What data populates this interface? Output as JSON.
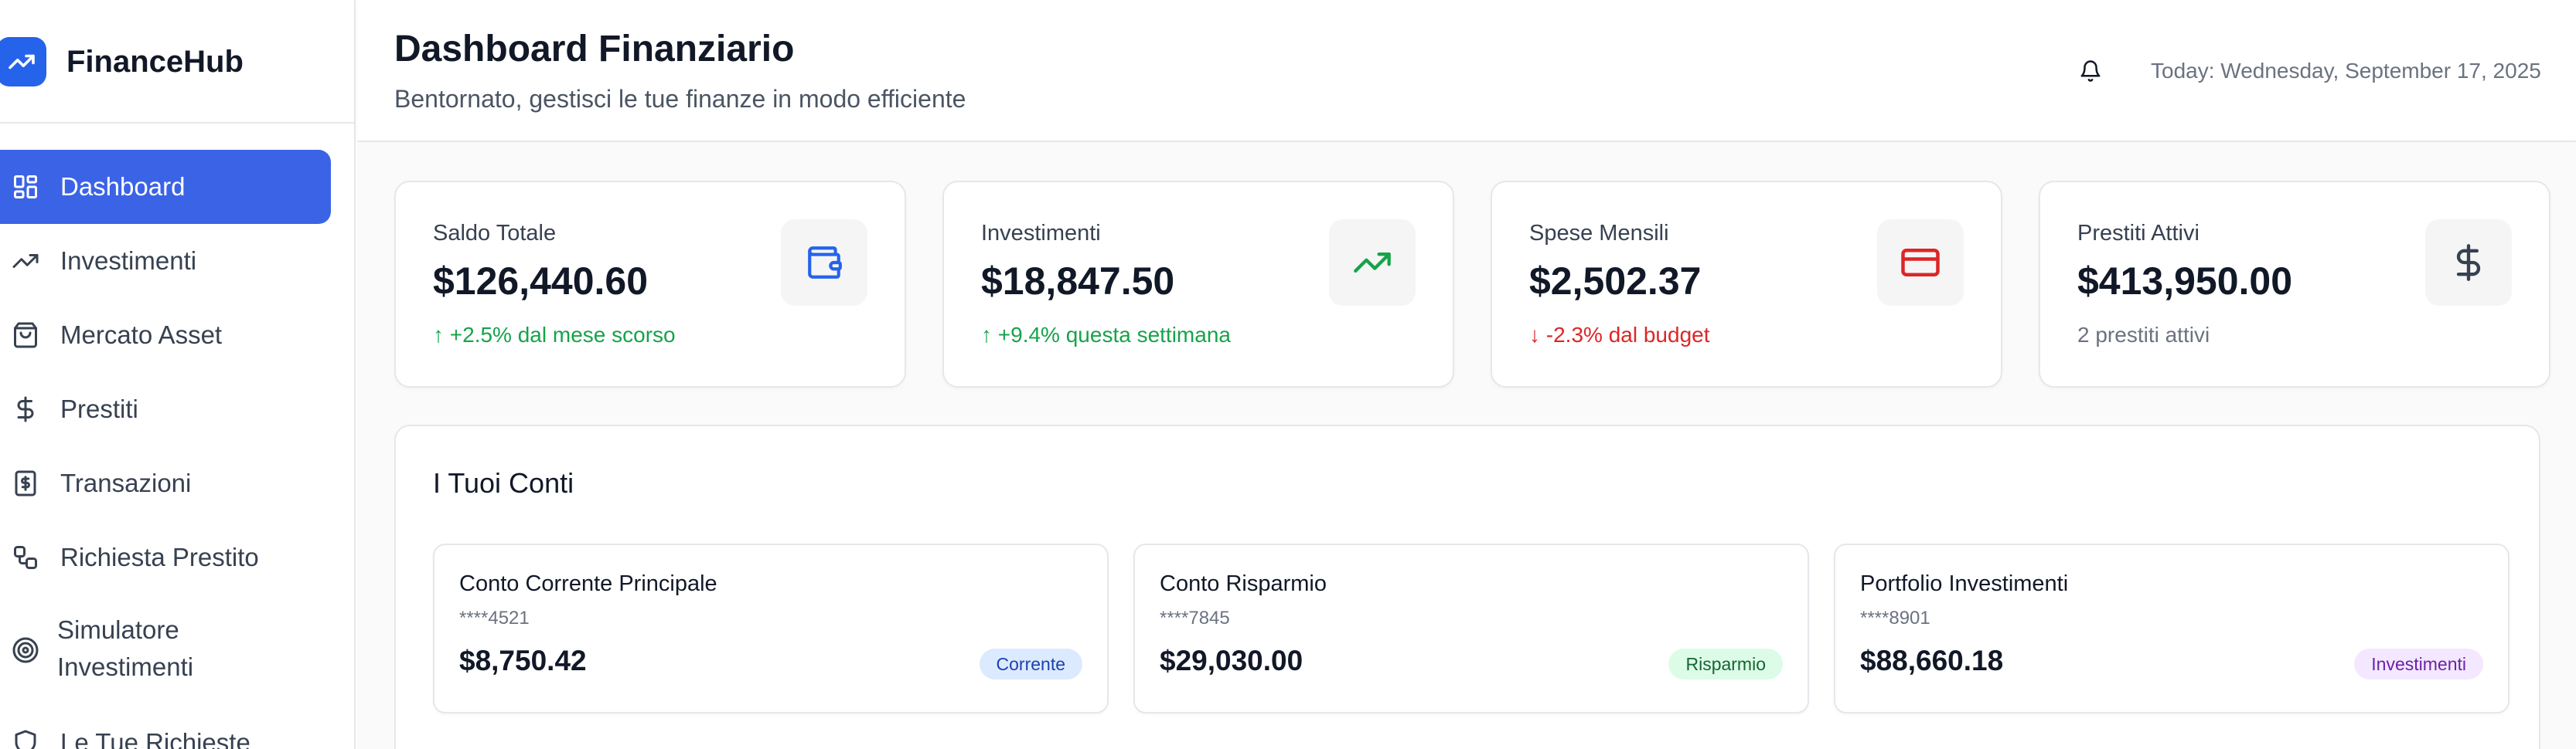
{
  "app": {
    "name": "FinanceHub"
  },
  "sidebar": {
    "items": [
      {
        "label": "Dashboard",
        "icon": "layout-grid-icon"
      },
      {
        "label": "Investimenti",
        "icon": "trending-up-icon"
      },
      {
        "label": "Mercato Asset",
        "icon": "shopping-bag-icon"
      },
      {
        "label": "Prestiti",
        "icon": "dollar-sign-icon"
      },
      {
        "label": "Transazioni",
        "icon": "receipt-icon"
      },
      {
        "label": "Richiesta Prestito",
        "icon": "workflow-icon"
      },
      {
        "label": "Simulatore Investimenti",
        "label_line1": "Simulatore",
        "label_line2": "Investimenti",
        "icon": "target-icon"
      },
      {
        "label": "Le Tue Richieste",
        "icon": "shield-icon"
      }
    ],
    "active_item": "Dashboard"
  },
  "header": {
    "title": "Dashboard Finanziario",
    "subtitle": "Bentornato, gestisci le tue finanze in modo efficiente",
    "today": "Today: Wednesday, September 17, 2025"
  },
  "stats": [
    {
      "label": "Saldo Totale",
      "value": "$126,440.60",
      "sub": "↑ +2.5% dal mese scorso",
      "trend": "up",
      "icon": "wallet-icon",
      "icon_color": "#2563eb"
    },
    {
      "label": "Investimenti",
      "value": "$18,847.50",
      "sub": "↑ +9.4% questa settimana",
      "trend": "up",
      "icon": "trending-up-icon",
      "icon_color": "#16a34a"
    },
    {
      "label": "Spese Mensili",
      "value": "$2,502.37",
      "sub": "↓ -2.3% dal budget",
      "trend": "down",
      "icon": "credit-card-icon",
      "icon_color": "#dc2626"
    },
    {
      "label": "Prestiti Attivi",
      "value": "$413,950.00",
      "sub": "2 prestiti attivi",
      "trend": "neutral",
      "icon": "dollar-sign-icon",
      "icon_color": "#374151"
    }
  ],
  "accounts": {
    "title": "I Tuoi Conti",
    "items": [
      {
        "name": "Conto Corrente Principale",
        "number": "****4521",
        "balance": "$8,750.42",
        "type": "Corrente"
      },
      {
        "name": "Conto Risparmio",
        "number": "****7845",
        "balance": "$29,030.00",
        "type": "Risparmio"
      },
      {
        "name": "Portfolio Investimenti",
        "number": "****8901",
        "balance": "$88,660.18",
        "type": "Investimenti"
      }
    ]
  },
  "colors": {
    "accent": "#3b63e6",
    "positive": "#16a34a",
    "negative": "#dc2626"
  }
}
